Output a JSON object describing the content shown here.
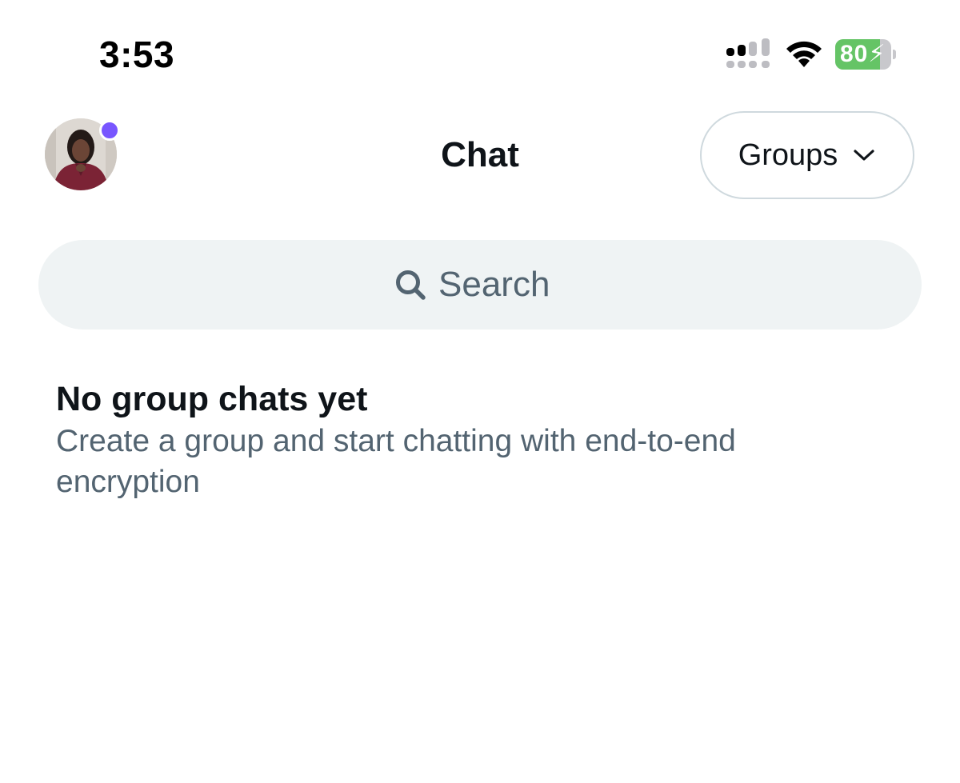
{
  "status_bar": {
    "time": "3:53",
    "battery_level": "80",
    "battery_percent": 80,
    "icons": [
      "signal-icon",
      "wifi-icon",
      "battery-charging-icon"
    ]
  },
  "header": {
    "title": "Chat",
    "filter_label": "Groups",
    "avatar_presence_color": "#7856ff"
  },
  "search": {
    "placeholder": "Search"
  },
  "empty_state": {
    "title": "No group chats yet",
    "description": "Create a group and start chatting with end-to-end encryption"
  },
  "colors": {
    "text_primary": "#0f1419",
    "text_secondary": "#536471",
    "search_bg": "#eff3f4",
    "battery_green": "#65c466",
    "accent": "#7856ff"
  }
}
